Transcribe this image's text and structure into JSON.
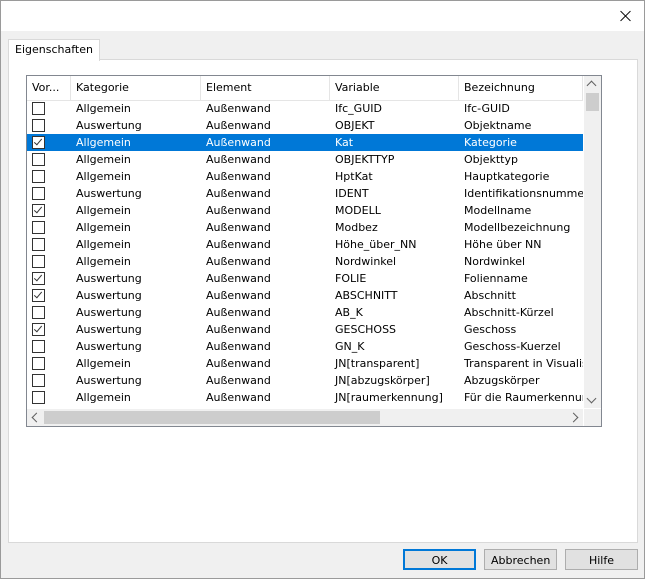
{
  "tab_label": "Eigenschaften",
  "columns": [
    "Vor...",
    "Kategorie",
    "Element",
    "Variable",
    "Bezeichnung"
  ],
  "rows": [
    {
      "checked": false,
      "kategorie": "Allgemein",
      "element": "Außenwand",
      "variable": "Ifc_GUID",
      "bezeichnung": "Ifc-GUID"
    },
    {
      "checked": false,
      "kategorie": "Auswertung",
      "element": "Außenwand",
      "variable": "OBJEKT",
      "bezeichnung": "Objektname"
    },
    {
      "checked": true,
      "selected": true,
      "kategorie": "Allgemein",
      "element": "Außenwand",
      "variable": "Kat",
      "bezeichnung": "Kategorie"
    },
    {
      "checked": false,
      "kategorie": "Allgemein",
      "element": "Außenwand",
      "variable": "OBJEKTTYP",
      "bezeichnung": "Objekttyp"
    },
    {
      "checked": false,
      "kategorie": "Allgemein",
      "element": "Außenwand",
      "variable": "HptKat",
      "bezeichnung": "Hauptkategorie"
    },
    {
      "checked": false,
      "kategorie": "Auswertung",
      "element": "Außenwand",
      "variable": "IDENT",
      "bezeichnung": "Identifikationsnummer"
    },
    {
      "checked": true,
      "kategorie": "Allgemein",
      "element": "Außenwand",
      "variable": "MODELL",
      "bezeichnung": "Modellname"
    },
    {
      "checked": false,
      "kategorie": "Allgemein",
      "element": "Außenwand",
      "variable": "Modbez",
      "bezeichnung": "Modellbezeichnung"
    },
    {
      "checked": false,
      "kategorie": "Allgemein",
      "element": "Außenwand",
      "variable": "Höhe_über_NN",
      "bezeichnung": "Höhe über NN"
    },
    {
      "checked": false,
      "kategorie": "Allgemein",
      "element": "Außenwand",
      "variable": "Nordwinkel",
      "bezeichnung": "Nordwinkel"
    },
    {
      "checked": true,
      "kategorie": "Auswertung",
      "element": "Außenwand",
      "variable": "FOLIE",
      "bezeichnung": "Folienname"
    },
    {
      "checked": true,
      "kategorie": "Auswertung",
      "element": "Außenwand",
      "variable": "ABSCHNITT",
      "bezeichnung": "Abschnitt"
    },
    {
      "checked": false,
      "kategorie": "Auswertung",
      "element": "Außenwand",
      "variable": "AB_K",
      "bezeichnung": "Abschnitt-Kürzel"
    },
    {
      "checked": true,
      "kategorie": "Auswertung",
      "element": "Außenwand",
      "variable": "GESCHOSS",
      "bezeichnung": "Geschoss"
    },
    {
      "checked": false,
      "kategorie": "Auswertung",
      "element": "Außenwand",
      "variable": "GN_K",
      "bezeichnung": "Geschoss-Kuerzel"
    },
    {
      "checked": false,
      "kategorie": "Allgemein",
      "element": "Außenwand",
      "variable": "JN[transparent]",
      "bezeichnung": "Transparent in Visualisier"
    },
    {
      "checked": false,
      "kategorie": "Auswertung",
      "element": "Außenwand",
      "variable": "JN[abzugskörper]",
      "bezeichnung": "Abzugskörper"
    },
    {
      "checked": false,
      "kategorie": "Allgemein",
      "element": "Außenwand",
      "variable": "JN[raumerkennung]",
      "bezeichnung": "Für die Raumerkennung b"
    }
  ],
  "buttons": {
    "ok": "OK",
    "cancel": "Abbrechen",
    "help": "Hilfe"
  },
  "colors": {
    "selection": "#0078d7",
    "default_button_border": "#0078d7"
  }
}
